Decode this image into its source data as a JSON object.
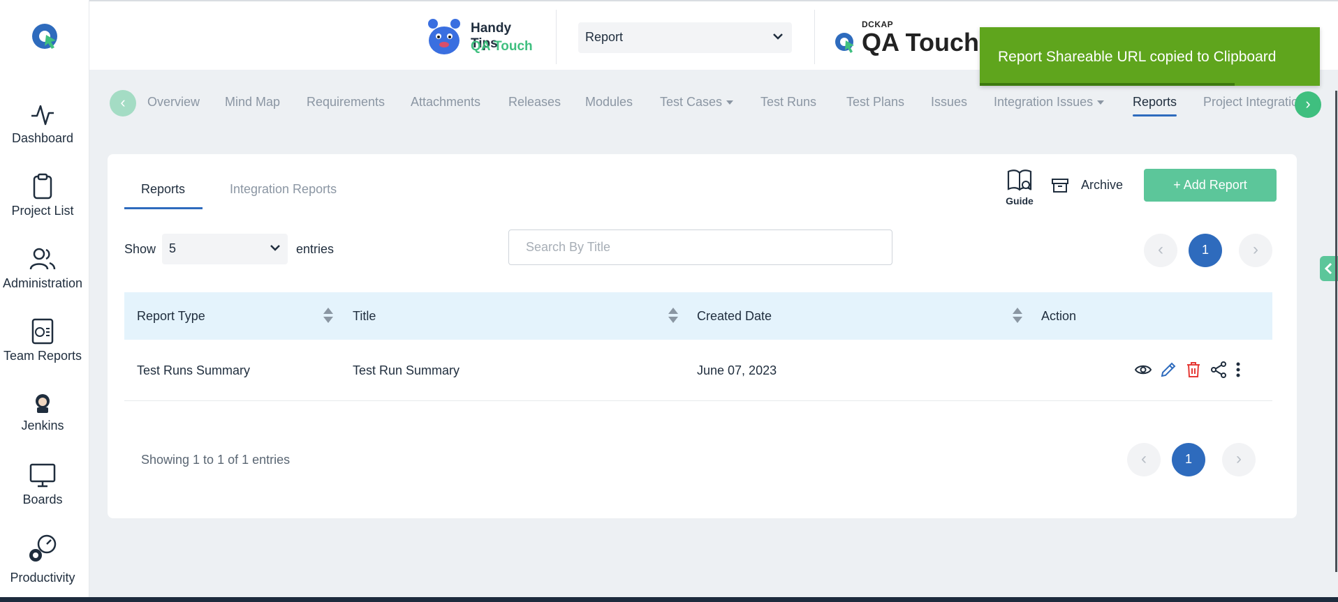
{
  "sidebar": {
    "items": [
      {
        "label": "Dashboard",
        "icon": "activity-icon"
      },
      {
        "label": "Project List",
        "icon": "clipboard-icon"
      },
      {
        "label": "Administration",
        "icon": "users-icon"
      },
      {
        "label": "Team Reports",
        "icon": "report-icon"
      },
      {
        "label": "Jenkins",
        "icon": "jenkins-icon"
      },
      {
        "label": "Boards",
        "icon": "presentation-board-icon"
      },
      {
        "label": "Productivity",
        "icon": "gear-gauge-icon"
      }
    ]
  },
  "header": {
    "handy_tips_line1": "Handy Tips",
    "handy_tips_line2": "QA Touch",
    "project_select_value": "Report",
    "brand_small": "DCKAP",
    "brand_name": "QA Touch"
  },
  "toast": {
    "message": "Report Shareable URL copied to Clipboard",
    "color": "#5fa51d",
    "progress": 0.75
  },
  "nav": {
    "tabs": [
      {
        "label": "Overview"
      },
      {
        "label": "Mind Map"
      },
      {
        "label": "Requirements"
      },
      {
        "label": "Attachments"
      },
      {
        "label": "Releases"
      },
      {
        "label": "Modules"
      },
      {
        "label": "Test Cases"
      },
      {
        "label": "Test Runs"
      },
      {
        "label": "Test Plans"
      },
      {
        "label": "Issues"
      },
      {
        "label": "Integration Issues"
      },
      {
        "label": "Reports"
      },
      {
        "label": "Project Integratio"
      }
    ],
    "active": "Reports"
  },
  "card": {
    "subtabs": [
      "Reports",
      "Integration Reports"
    ],
    "guide_label": "Guide",
    "archive_label": "Archive",
    "add_report_label": "+ Add Report",
    "show_label": "Show",
    "entries_value": "5",
    "entries_label": "entries",
    "search_placeholder": "Search By Title",
    "pagination": {
      "prev": "‹",
      "current": "1",
      "next": "›"
    },
    "table": {
      "columns": [
        "Report Type",
        "Title",
        "Created Date",
        "Action"
      ],
      "rows": [
        {
          "report_type": "Test Runs Summary",
          "title": "Test Run Summary",
          "created_date": "June 07, 2023"
        }
      ]
    },
    "showing_text": "Showing 1 to 1 of 1 entries"
  },
  "colors": {
    "accent_blue": "#2e6bbd",
    "accent_green": "#5cc69a",
    "table_header_bg": "#e4f3fc",
    "delete_red": "#e53935"
  }
}
